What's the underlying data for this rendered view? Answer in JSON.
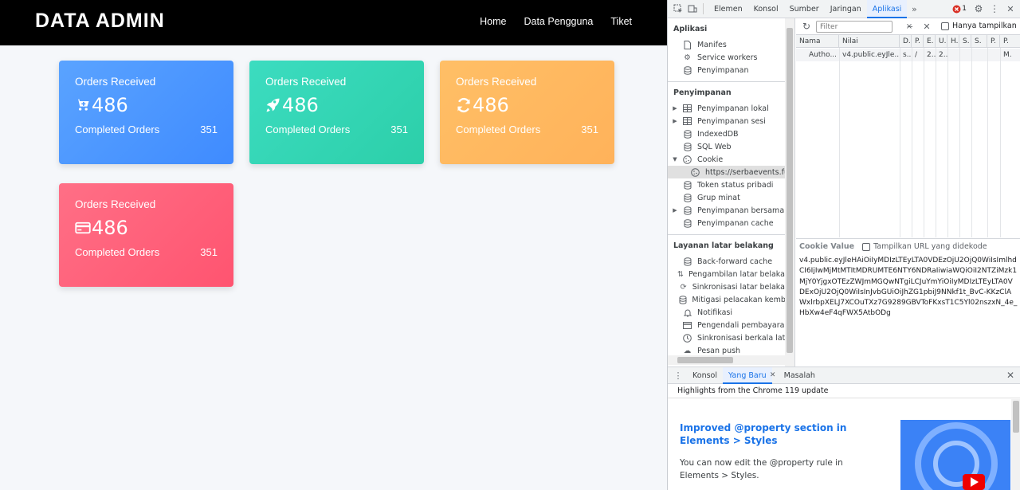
{
  "site": {
    "brand": "DATA ADMIN",
    "nav": [
      "Home",
      "Data Pengguna",
      "Tiket"
    ]
  },
  "cards": [
    {
      "title": "Orders Received",
      "value": "486",
      "footer_label": "Completed Orders",
      "footer_value": "351",
      "icon": "cart-icon",
      "color": "#4d9bff"
    },
    {
      "title": "Orders Received",
      "value": "486",
      "footer_label": "Completed Orders",
      "footer_value": "351",
      "icon": "rocket-icon",
      "color": "#2fd7b4"
    },
    {
      "title": "Orders Received",
      "value": "486",
      "footer_label": "Completed Orders",
      "footer_value": "351",
      "icon": "refresh-icon",
      "color": "#ffb74d"
    },
    {
      "title": "Orders Received",
      "value": "486",
      "footer_label": "Completed Orders",
      "footer_value": "351",
      "icon": "credit-card-icon",
      "color": "#ff5e7a"
    }
  ],
  "devtools": {
    "tabs": [
      "Elemen",
      "Konsol",
      "Sumber",
      "Jaringan",
      "Aplikasi"
    ],
    "active_tab": "Aplikasi",
    "error_count": "1",
    "sidebar": {
      "aplikasi_header": "Aplikasi",
      "aplikasi_items": [
        "Manifes",
        "Service workers",
        "Penyimpanan"
      ],
      "storage_header": "Penyimpanan",
      "storage_items": [
        "Penyimpanan lokal",
        "Penyimpanan sesi",
        "IndexedDB",
        "SQL Web",
        "Cookie"
      ],
      "cookie_child": "https://serbaevents.fun",
      "storage_items_2": [
        "Token status pribadi",
        "Grup minat",
        "Penyimpanan bersama",
        "Penyimpanan cache"
      ],
      "background_header": "Layanan latar belakang",
      "background_items": [
        "Back-forward cache",
        "Pengambilan latar belakang",
        "Sinkronisasi latar belakang",
        "Mitigasi pelacakan kembali",
        "Notifikasi",
        "Pengendali pembayaran",
        "Sinkronisasi berkala latar",
        "Pesan push"
      ]
    },
    "filter_placeholder": "Filter",
    "only_show_label": "Hanya tampilkan",
    "table_headers": [
      "Nama",
      "Nilai",
      "D.",
      "P.",
      "E.",
      "U.",
      "H.",
      "S.",
      "S.",
      "P.",
      "P."
    ],
    "table_row": [
      "Autho...",
      "v4.public.eyJle...",
      "s...",
      "/",
      "2...",
      "2...",
      "",
      "",
      "",
      "",
      "M."
    ],
    "cookie_value_label": "Cookie Value",
    "show_url_decoded": "Tampilkan URL yang didekode",
    "cookie_value": "v4.public.eyJleHAiOiIyMDIzLTEyLTA0VDEzOjU2OjQ0WiIsImlhdCI6IjIwMjMtMTItMDRUMTE6NTY6NDRaIiwiaWQiOiI2NTZiMzk1MjY0YjgxOTEzZWJmMGQwNTgiLCJuYmYiOiIyMDIzLTEyLTA0VDExOjU2OjQ0WiIsInJvbGUiOiJhZG1pbiJ9NNkf1t_BvC-KKzClAWxlrbpXELJ7XCOuTXz7G9289GBVToFKxsT1C5Yl02nszxN_4e_HbXw4eF4qFWX5AtbODg",
    "drawer": {
      "tabs": [
        "Konsol",
        "Yang Baru",
        "Masalah"
      ],
      "active_tab": "Yang Baru",
      "highlights": "Highlights from the Chrome 119 update",
      "title": "Improved @property section in Elements > Styles",
      "body": "You can now edit the @property rule in Elements > Styles."
    }
  }
}
